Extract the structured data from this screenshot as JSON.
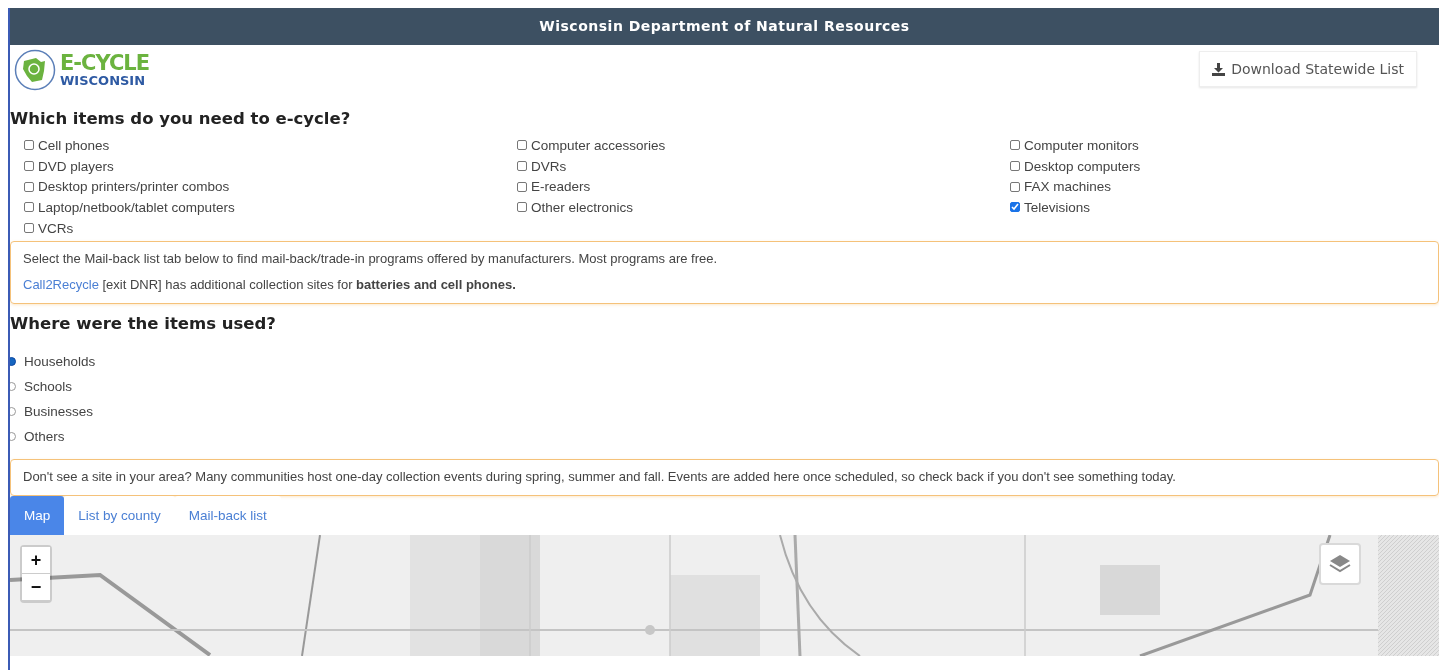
{
  "header": {
    "title": "Wisconsin Department of Natural Resources"
  },
  "logo": {
    "line1": "E-CYCLE",
    "line2": "WISCONSIN"
  },
  "download_button": {
    "label": "Download Statewide List"
  },
  "items_section": {
    "heading": "Which items do you need to e-cycle?",
    "items": [
      {
        "label": "Cell phones",
        "checked": false
      },
      {
        "label": "Computer accessories",
        "checked": false
      },
      {
        "label": "Computer monitors",
        "checked": false
      },
      {
        "label": "DVD players",
        "checked": false
      },
      {
        "label": "DVRs",
        "checked": false
      },
      {
        "label": "Desktop computers",
        "checked": false
      },
      {
        "label": "Desktop printers/printer combos",
        "checked": false
      },
      {
        "label": "E-readers",
        "checked": false
      },
      {
        "label": "FAX machines",
        "checked": false
      },
      {
        "label": "Laptop/netbook/tablet computers",
        "checked": false
      },
      {
        "label": "Other electronics",
        "checked": false
      },
      {
        "label": "Televisions",
        "checked": true
      },
      {
        "label": "VCRs",
        "checked": false
      }
    ]
  },
  "mail_notice": {
    "text": "Select the Mail-back list tab below to find mail-back/trade-in programs offered by manufacturers. Most programs are free.",
    "link": "Call2Recycle",
    "link_rest": " [exit DNR] has additional collection sites for **batteries and cell phones.**"
  },
  "usage_section": {
    "heading": "Where were the items used?",
    "options": [
      {
        "label": "Households",
        "selected": true
      },
      {
        "label": "Schools",
        "selected": false
      },
      {
        "label": "Businesses",
        "selected": false
      },
      {
        "label": "Others",
        "selected": false
      }
    ]
  },
  "events_notice": {
    "text": "Don't see a site in your area? Many communities host one-day collection events during spring, summer and fall. Events are added here once scheduled, so check back if you don't see something today."
  },
  "tabs": [
    {
      "label": "Map",
      "selected": true
    },
    {
      "label": "List by county",
      "selected": false
    },
    {
      "label": "Mail-back list",
      "selected": false
    }
  ],
  "map": {
    "zoom_in": "+",
    "zoom_out": "−"
  }
}
